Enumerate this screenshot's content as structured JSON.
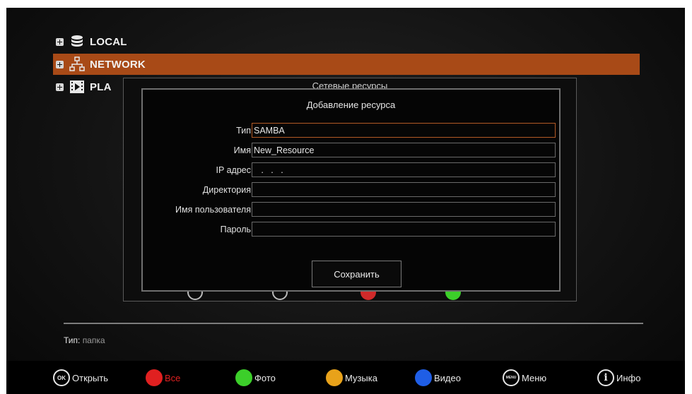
{
  "tree": {
    "items": [
      {
        "label": "LOCAL",
        "icon": "database-icon"
      },
      {
        "label": "NETWORK",
        "icon": "network-icon"
      },
      {
        "label": "PLA",
        "icon": "film-icon"
      }
    ]
  },
  "panel": {
    "title": "Сетевые ресурсы"
  },
  "dialog": {
    "title": "Добавление ресурса",
    "fields": [
      {
        "label": "Тип",
        "value": "SAMBA"
      },
      {
        "label": "Имя",
        "value": "New_Resource"
      },
      {
        "label": "IP адрес",
        "value": "   .   .   ."
      },
      {
        "label": "Директория",
        "value": ""
      },
      {
        "label": "Имя пользователя",
        "value": ""
      },
      {
        "label": "Пароль",
        "value": ""
      }
    ],
    "save_label": "Сохранить"
  },
  "status": {
    "label": "Тип:",
    "value": "папка"
  },
  "bottom_bar": {
    "hints": [
      {
        "key": "OK",
        "label": "Открыть",
        "color": "#ffffff"
      },
      {
        "key": "red",
        "label": "Все",
        "color": "#e02020"
      },
      {
        "key": "green",
        "label": "Фото",
        "color": "#3ccf2a"
      },
      {
        "key": "yellow",
        "label": "Музыка",
        "color": "#e8a21a"
      },
      {
        "key": "blue",
        "label": "Видео",
        "color": "#1f5ee6"
      },
      {
        "key": "MENU",
        "label": "Меню",
        "color": "#ffffff"
      },
      {
        "key": "i",
        "label": "Инфо",
        "color": "#ffffff"
      }
    ]
  },
  "colors": {
    "selection": "#a84a17",
    "focus_border": "#b35a25"
  }
}
